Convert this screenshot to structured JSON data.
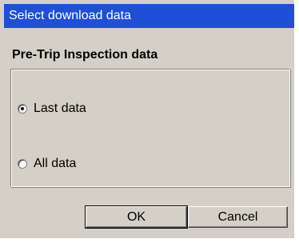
{
  "dialog": {
    "title": "Select download data",
    "section_heading": "Pre-Trip Inspection data",
    "options": [
      {
        "label": "Last data",
        "selected": true
      },
      {
        "label": "All data",
        "selected": false
      }
    ],
    "buttons": {
      "ok_label": "OK",
      "cancel_label": "Cancel"
    }
  },
  "colors": {
    "title_bar": "#1f4fd6",
    "dialog_face": "#d4d0c8"
  }
}
